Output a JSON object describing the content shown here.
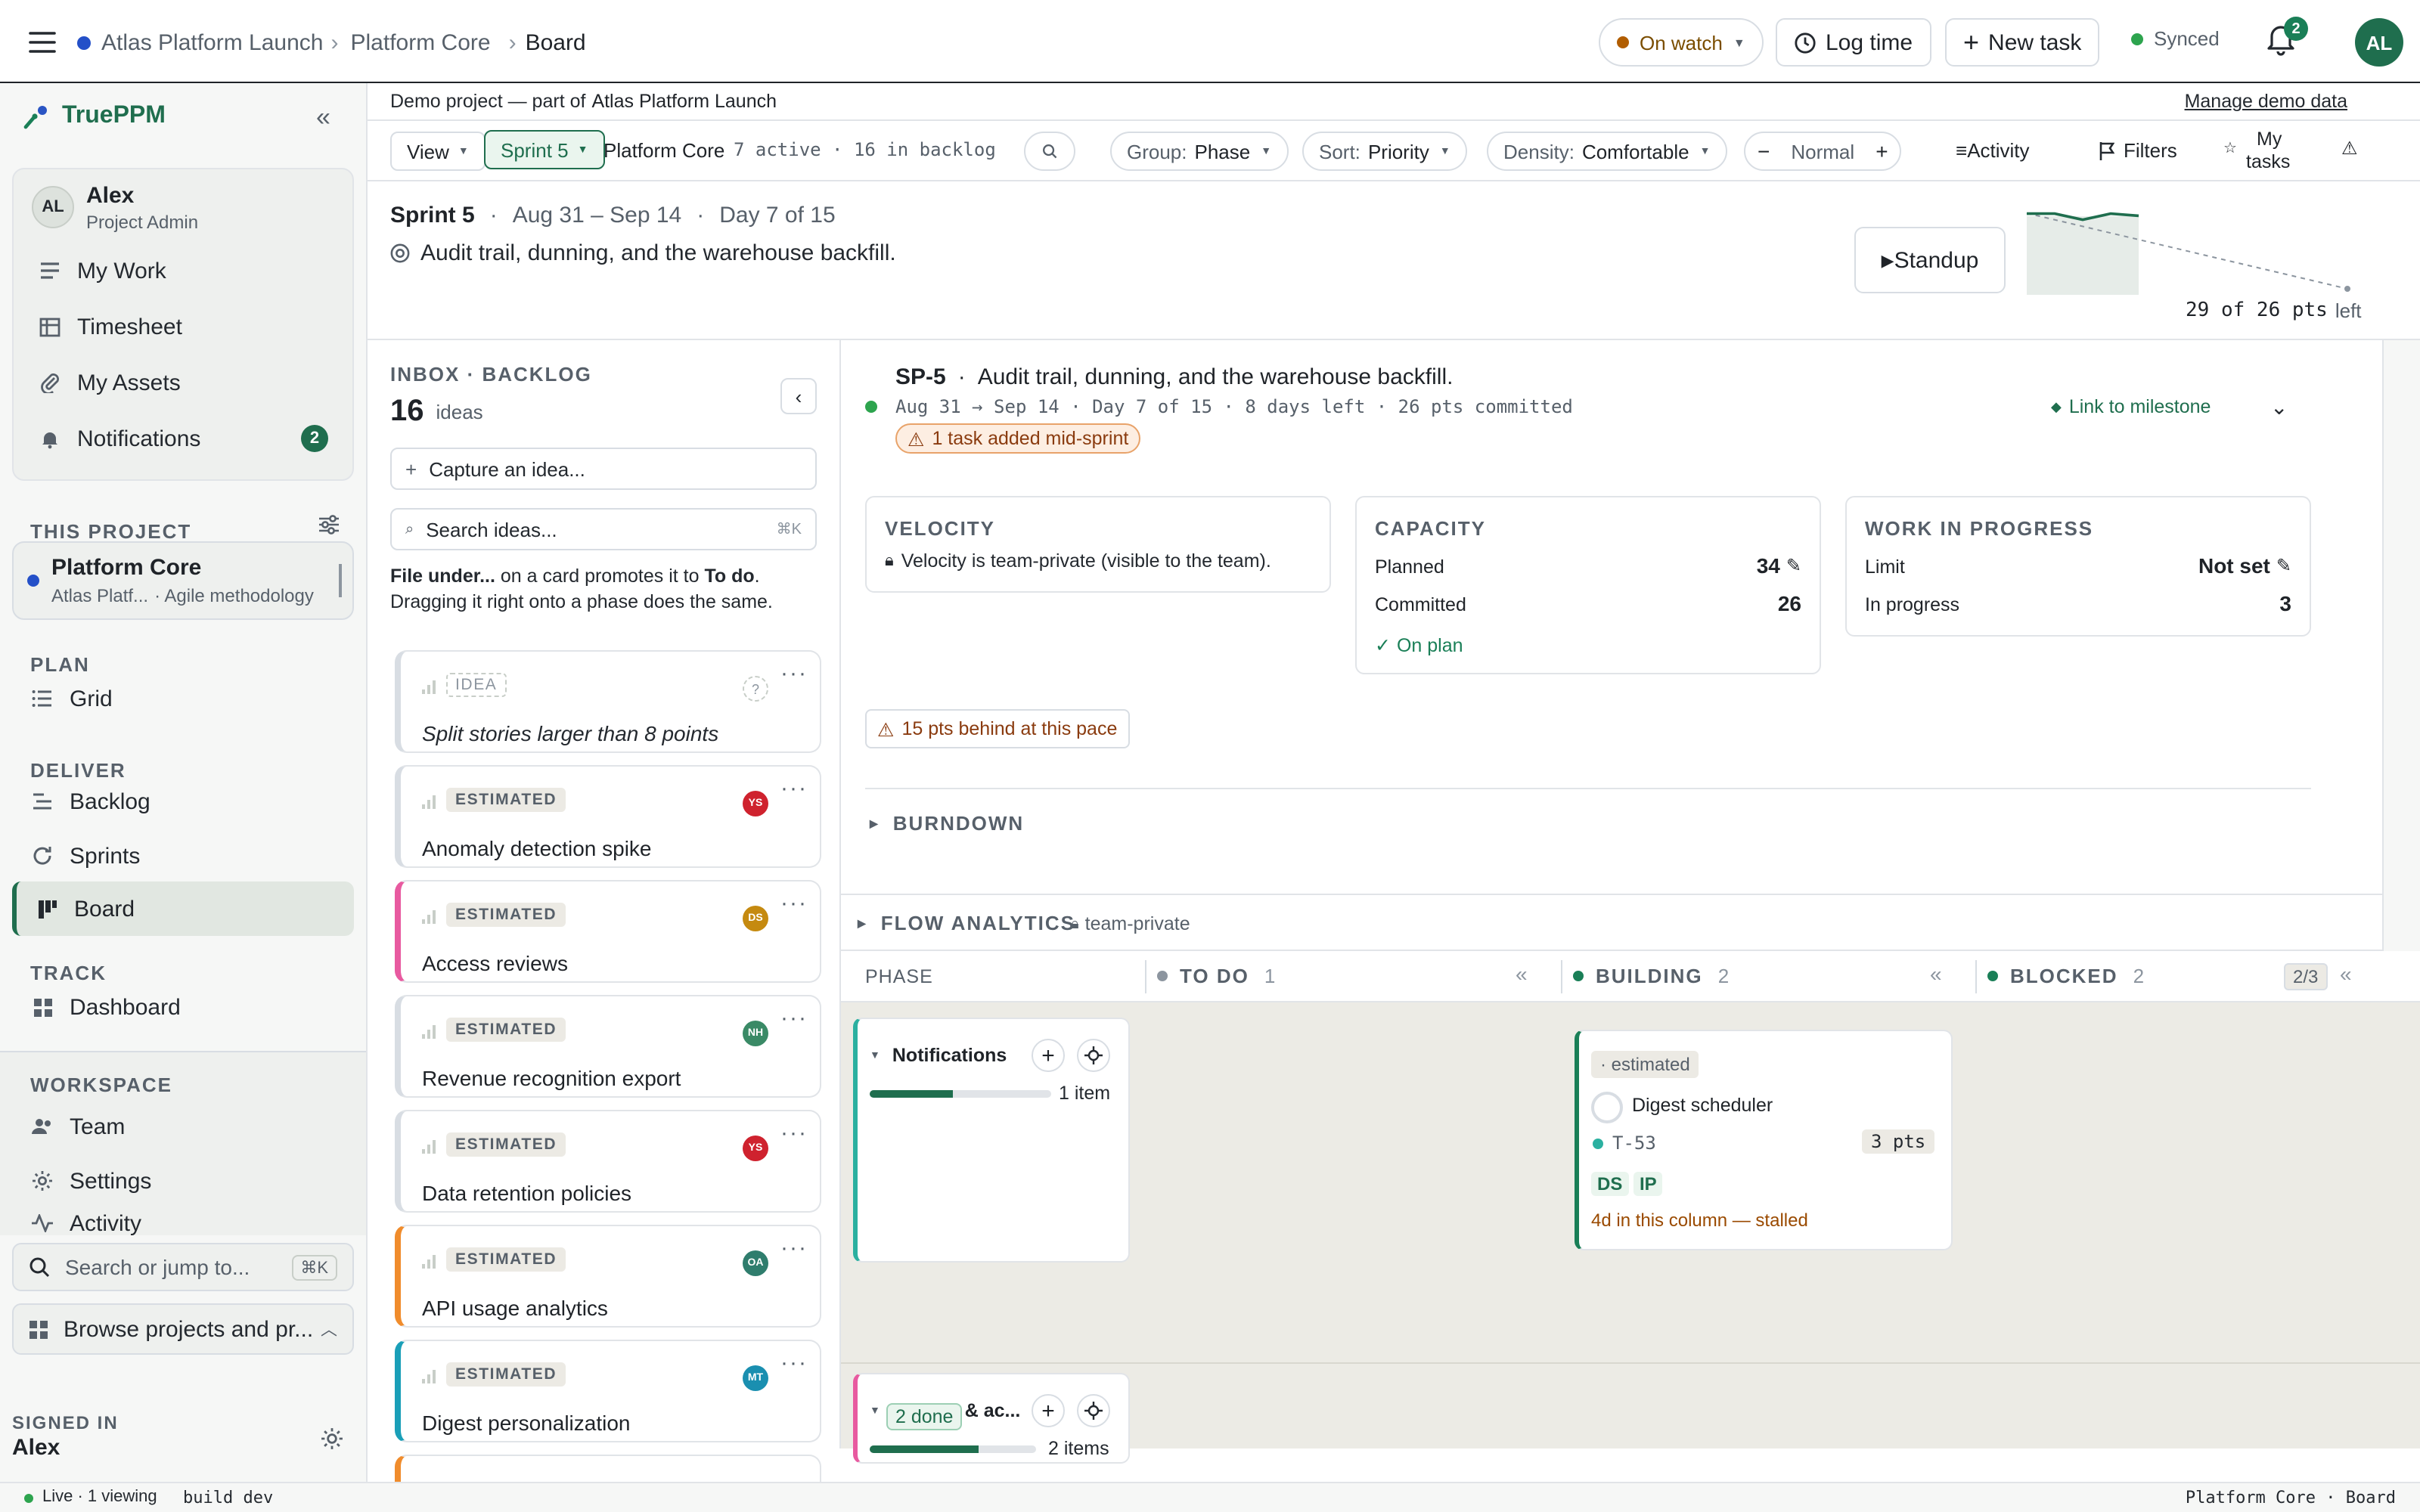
{
  "topbar": {
    "breadcrumb": [
      "Atlas Platform Launch",
      "Platform Core",
      "Board"
    ],
    "watch_label": "On watch",
    "log_time": "Log time",
    "new_task": "New task",
    "sync_status": "Synced",
    "notif_count": "2",
    "user_initials": "AL"
  },
  "sidebar": {
    "brand": "TruePPM",
    "user": {
      "initials": "AL",
      "name": "Alex",
      "role": "Project Admin"
    },
    "user_nav": [
      {
        "label": "My Work",
        "icon": "list-icon"
      },
      {
        "label": "Timesheet",
        "icon": "table-icon"
      },
      {
        "label": "My Assets",
        "icon": "paperclip-icon"
      },
      {
        "label": "Notifications",
        "icon": "bell-icon",
        "count": "2"
      }
    ],
    "this_project_label": "THIS PROJECT",
    "project": {
      "name": "Platform Core",
      "parent": "Atlas Platf...",
      "method": "· Agile methodology"
    },
    "plan_label": "PLAN",
    "plan_items": [
      {
        "label": "Grid",
        "icon": "list-icon"
      }
    ],
    "deliver_label": "DELIVER",
    "deliver_items": [
      {
        "label": "Backlog",
        "icon": "backlog-icon"
      },
      {
        "label": "Sprints",
        "icon": "refresh-icon"
      },
      {
        "label": "Board",
        "icon": "board-icon"
      }
    ],
    "track_label": "TRACK",
    "track_items": [
      {
        "label": "Dashboard",
        "icon": "dashboard-icon"
      }
    ],
    "workspace_label": "WORKSPACE",
    "workspace_items": [
      {
        "label": "Team",
        "icon": "team-icon"
      },
      {
        "label": "Settings",
        "icon": "gear-icon"
      },
      {
        "label": "Activity",
        "icon": "activity-icon"
      }
    ],
    "search_placeholder": "Search or jump to...",
    "search_kbd": "⌘K",
    "browse": "Browse projects and pr...",
    "signed_in_label": "SIGNED IN",
    "signed_in_user": "Alex"
  },
  "demo_banner": {
    "text": "Demo project — part of",
    "project": "Atlas Platform Launch",
    "manage": "Manage demo data"
  },
  "toolbar": {
    "view": "View",
    "sprint": "Sprint 5",
    "project": "Platform Core",
    "counts": "7 active · 16 in backlog",
    "group_label": "Group:",
    "group_value": "Phase",
    "sort_label": "Sort:",
    "sort_value": "Priority",
    "density_label": "Density:",
    "density_value": "Comfortable",
    "zoom_value": "Normal",
    "activity": "Activity",
    "filters": "Filters",
    "my_tasks_1": "My",
    "my_tasks_2": "tasks"
  },
  "sprint_header": {
    "name": "Sprint 5",
    "dates": "Aug 31 – Sep 14",
    "day": "Day 7 of 15",
    "goal": "Audit trail, dunning, and the warehouse backfill.",
    "standup": "Standup",
    "pts_left": "29 of 26 pts",
    "pts_left_suffix": "left"
  },
  "inbox": {
    "title": "INBOX · BACKLOG",
    "count": "16",
    "count_label": "ideas",
    "capture_placeholder": "Capture an idea...",
    "search_placeholder": "Search ideas...",
    "search_kbd": "⌘K",
    "hint_1": "File under...",
    "hint_2": " on a card promotes it to ",
    "hint_3": "To do",
    "hint_4": ".",
    "hint_5": "Dragging it right onto a phase does the same.",
    "cards": [
      {
        "badge": "IDEA",
        "title": "Split stories larger than 8 points",
        "avatar": "?",
        "color": "#d8dde3"
      },
      {
        "badge": "ESTIMATED",
        "title": "Anomaly detection spike",
        "avatar": "YS",
        "color": "#d8dde3",
        "avatar_color": "#cf222e"
      },
      {
        "badge": "ESTIMATED",
        "title": "Access reviews",
        "avatar": "DS",
        "color": "#e85aa0",
        "avatar_color": "#c58a10"
      },
      {
        "badge": "ESTIMATED",
        "title": "Revenue recognition export",
        "avatar": "NH",
        "color": "#d8dde3",
        "avatar_color": "#3a8a66"
      },
      {
        "badge": "ESTIMATED",
        "title": "Data retention policies",
        "avatar": "YS",
        "color": "#d8dde3",
        "avatar_color": "#cf222e"
      },
      {
        "badge": "ESTIMATED",
        "title": "API usage analytics",
        "avatar": "OA",
        "color": "#f08c2c",
        "avatar_color": "#2f7d6d"
      },
      {
        "badge": "ESTIMATED",
        "title": "Digest personalization",
        "avatar": "MT",
        "color": "#1a9fb8",
        "avatar_color": "#1a8fb0"
      }
    ]
  },
  "sprint_detail": {
    "key": "SP-5",
    "title": "Audit trail, dunning, and the warehouse backfill.",
    "meta": "Aug 31 → Sep 14 · Day 7 of 15 · 8 days left · 26 pts committed",
    "warning": "1 task added mid-sprint",
    "link_milestone": "Link to milestone",
    "velocity": {
      "title": "VELOCITY",
      "note": "Velocity is team-private (visible to the team)."
    },
    "capacity": {
      "title": "CAPACITY",
      "planned_label": "Planned",
      "planned": "34",
      "committed_label": "Committed",
      "committed": "26",
      "status": "On plan"
    },
    "wip": {
      "title": "WORK IN PROGRESS",
      "limit_label": "Limit",
      "limit": "Not set",
      "in_progress_label": "In progress",
      "in_progress": "3"
    },
    "behind": "15 pts behind at this pace",
    "burndown": "BURNDOWN",
    "flow": "FLOW ANALYTICS",
    "flow_badge": "team-private"
  },
  "board": {
    "phase_label": "PHASE",
    "columns": [
      {
        "name": "TO DO",
        "count": "1"
      },
      {
        "name": "BUILDING",
        "count": "2"
      },
      {
        "name": "BLOCKED",
        "count": "2",
        "wip": "2/3"
      }
    ],
    "swimlanes": [
      {
        "name": "Notifications",
        "count": "1 item",
        "progress": 0.46
      },
      {
        "name": "Identity & ac...",
        "count": "2 items",
        "progress": 0.65,
        "done": "2 done"
      }
    ],
    "task": {
      "badge": "· estimated",
      "title": "Digest scheduler",
      "id": "T-53",
      "points": "3 pts",
      "tags": [
        "DS",
        "IP"
      ],
      "stalled": "4d in this column — stalled"
    }
  },
  "statusbar": {
    "live": "Live · 1 viewing",
    "build": "build dev",
    "location": "Platform Core · Board"
  },
  "chart_data": {
    "type": "line",
    "series": [
      {
        "values": [
          29,
          29,
          26,
          29,
          28
        ]
      }
    ],
    "ylim": [
      0,
      30
    ]
  }
}
